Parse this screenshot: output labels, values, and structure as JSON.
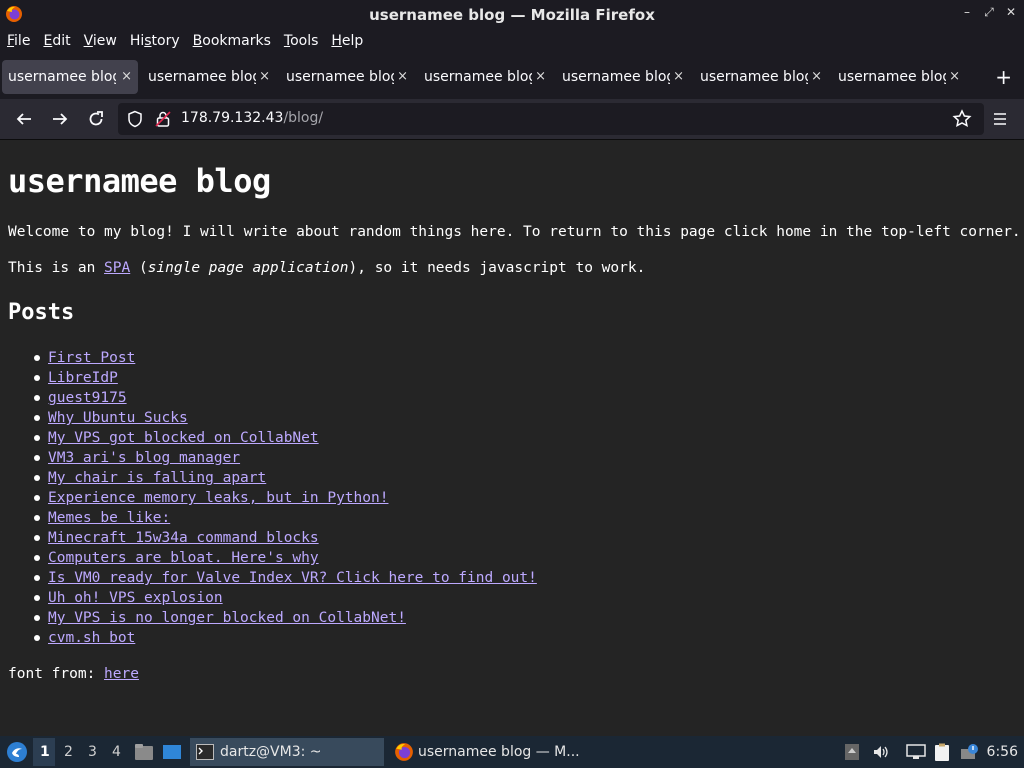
{
  "window": {
    "title": "usernamee blog — Mozilla Firefox",
    "controls": [
      "minimize-icon",
      "restore-icon",
      "close-icon"
    ]
  },
  "menubar": [
    {
      "key": "F",
      "rest": "ile"
    },
    {
      "key": "E",
      "rest": "dit"
    },
    {
      "key": "V",
      "rest": "iew"
    },
    {
      "key": "H",
      "rest": "istory",
      "pre": "Hi",
      "post": "tory",
      "u": "s"
    },
    {
      "key": "B",
      "rest": "ookmarks"
    },
    {
      "key": "T",
      "rest": "ools"
    },
    {
      "key": "H",
      "rest": "elp"
    }
  ],
  "tabs": [
    {
      "label": "usernamee blog",
      "active": true
    },
    {
      "label": "usernamee blog",
      "active": false
    },
    {
      "label": "usernamee blog",
      "active": false
    },
    {
      "label": "usernamee blog",
      "active": false
    },
    {
      "label": "usernamee blog",
      "active": false
    },
    {
      "label": "usernamee blog",
      "active": false
    },
    {
      "label": "usernamee blog",
      "active": false
    }
  ],
  "tab_close": "×",
  "new_tab": "+",
  "navbar": {
    "url_host": "178.79.132.43",
    "url_path": "/blog/"
  },
  "page": {
    "title": "usernamee blog",
    "intro": "Welcome to my blog! I will write about random things here. To return to this page click home in the top-left corner.",
    "spa_prefix": "This is an ",
    "spa_link": "SPA",
    "spa_mid": " (",
    "spa_em": "single page application",
    "spa_suffix": "), so it needs javascript to work.",
    "posts_heading": "Posts",
    "posts": [
      "First Post",
      "LibreIdP",
      "guest9175",
      "Why Ubuntu Sucks",
      "My VPS got blocked on CollabNet",
      "VM3 ari's blog manager",
      "My chair is falling apart",
      "Experience memory leaks, but in Python!",
      "Memes be like:",
      "Minecraft 15w34a command blocks",
      "Computers are bloat. Here's why",
      "Is VM0 ready for Valve Index VR? Click here to find out!",
      "Uh oh! VPS explosion",
      "My VPS is no longer blocked on CollabNet!",
      "cvm.sh bot"
    ],
    "font_prefix": "font from: ",
    "font_link": "here"
  },
  "taskbar": {
    "workspaces": [
      "1",
      "2",
      "3",
      "4"
    ],
    "tasks": [
      {
        "label": "dartz@VM3: ~",
        "icon": "terminal-icon"
      },
      {
        "label": "usernamee blog — M...",
        "icon": "firefox-icon"
      }
    ],
    "clock": "6:56"
  },
  "colors": {
    "link": "#bda9ff",
    "content_bg": "#242424",
    "chrome_bg": "#1c1b22",
    "taskbar_bg": "#1b2734"
  }
}
